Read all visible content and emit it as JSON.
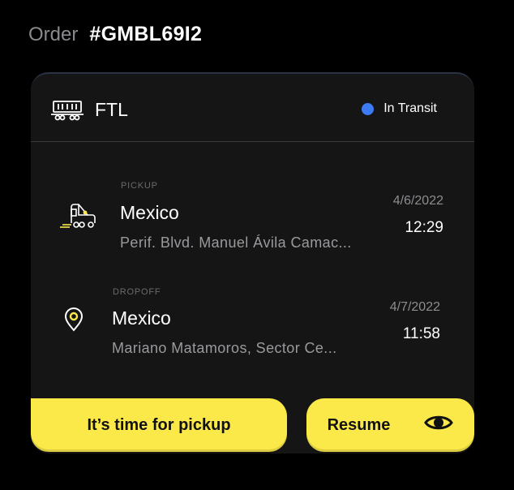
{
  "order": {
    "label": "Order",
    "id": "#GMBL69I2"
  },
  "shipment": {
    "type": "FTL",
    "type_icon": "freight-car-icon",
    "status": "In Transit",
    "status_color": "#3d7bf5"
  },
  "stops": [
    {
      "kind": "PICKUP",
      "icon": "truck-icon",
      "city": "Mexico",
      "address": "Perif. Blvd. Manuel Ávila Camac...",
      "date": "4/6/2022",
      "time": "12:29"
    },
    {
      "kind": "DROPOFF",
      "icon": "location-pin-icon",
      "city": "Mexico",
      "address": "Mariano Matamoros, Sector Ce...",
      "date": "4/7/2022",
      "time": "11:58"
    }
  ],
  "actions": {
    "pickup_label": "It’s time for pickup",
    "resume_label": "Resume",
    "resume_icon": "eye-icon"
  },
  "colors": {
    "accent": "#fbe94a",
    "card_background": "#151515",
    "page_background": "#000000"
  }
}
